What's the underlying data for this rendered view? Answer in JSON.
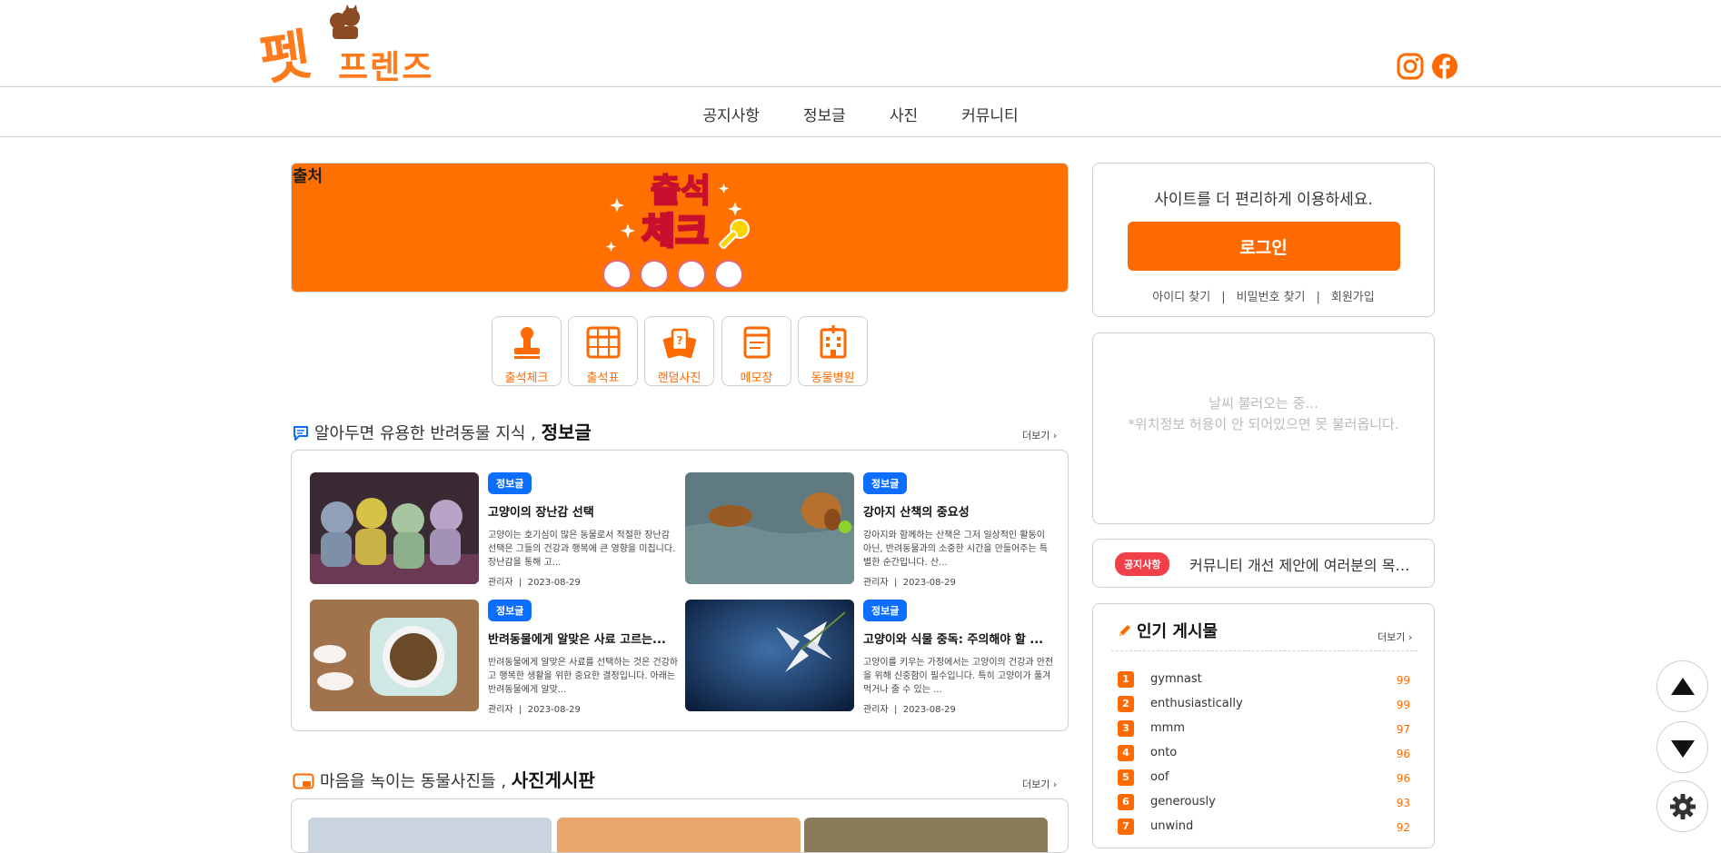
{
  "header": {
    "logo_text": "펫",
    "logo_sub": "프렌즈",
    "instagram_icon": "instagram-icon",
    "facebook_icon": "facebook-icon"
  },
  "nav": {
    "items": [
      {
        "label": "공지사항"
      },
      {
        "label": "정보글"
      },
      {
        "label": "사진"
      },
      {
        "label": "커뮤니티"
      }
    ]
  },
  "banner": {
    "source_label": "출처",
    "art_line1": "출석",
    "art_line2": "체크",
    "stamp_text": "출석체크"
  },
  "quick_menu": [
    {
      "label": "출석체크",
      "icon": "stamp-icon"
    },
    {
      "label": "출석표",
      "icon": "table-icon"
    },
    {
      "label": "랜덤사진",
      "icon": "cards-icon"
    },
    {
      "label": "메모장",
      "icon": "memo-icon"
    },
    {
      "label": "동물병원",
      "icon": "hospital-icon"
    }
  ],
  "info_section": {
    "heading_prefix": "알아두면 유용한 반려동물 지식 ,",
    "heading_strong": "정보글",
    "more": "더보기 ›",
    "posts": [
      {
        "badge": "정보글",
        "title": "고양이의 장난감 선택",
        "text": " 고양이는 호기심이 많은 동물로서 적절한 장난감 선택은 그들의 건강과 행복에 큰 영향을 미칩니다. 장난감을 통해 고...",
        "author": "관리자",
        "date": "2023-08-29"
      },
      {
        "badge": "정보글",
        "title": "강아지 산책의 중요성",
        "text": " 강아지와 함께하는 산책은 그저 일상적인 활동이 아닌, 반려동물과의 소중한 시간을 만들어주는 특별한 순간입니다. 산...",
        "author": "관리자",
        "date": "2023-08-29"
      },
      {
        "badge": "정보글",
        "title": "반려동물에게 알맞은 사료 고르는...",
        "text": " 반려동물에게 알맞은 사료를 선택하는 것은 건강하고 행복한 생활을 위한 중요한 결정입니다. 아래는 반려동물에게 알맞...",
        "author": "관리자",
        "date": "2023-08-29"
      },
      {
        "badge": "정보글",
        "title": "고양이와 식물 중독: 주의해야 할 ...",
        "text": " 고양이를 키우는 가정에서는 고양이의 건강과 안전을 위해 신중함이 필수입니다. 특히 고양이가 풀겨 먹거나 줄 수 있는 ...",
        "author": "관리자",
        "date": "2023-08-29"
      }
    ]
  },
  "photo_section": {
    "heading_prefix": "마음을 녹이는 동물사진들 ,",
    "heading_strong": "사진게시판",
    "more": "더보기 ›"
  },
  "login": {
    "message": "사이트를 더 편리하게 이용하세요.",
    "button": "로그인",
    "find_id": "아이디 찾기",
    "find_pw": "비밀번호 찾기",
    "signup": "회원가입",
    "sep": "|"
  },
  "weather": {
    "line1": "날씨 불러오는 중...",
    "line2": "*위치정보 허용이 안 되어있으면 못 불러옵니다."
  },
  "notice": {
    "badge": "공지사항",
    "text": "커뮤니티 개선 제안에 여러분의 목소리를 들려주세요"
  },
  "popular": {
    "title": "인기 게시물",
    "more": "더보기 ›",
    "items": [
      {
        "rank": "1",
        "name": "gymnast",
        "count": "99"
      },
      {
        "rank": "2",
        "name": "enthusiastically",
        "count": "99"
      },
      {
        "rank": "3",
        "name": "mmm",
        "count": "97"
      },
      {
        "rank": "4",
        "name": "onto",
        "count": "96"
      },
      {
        "rank": "5",
        "name": "oof",
        "count": "96"
      },
      {
        "rank": "6",
        "name": "generously",
        "count": "93"
      },
      {
        "rank": "7",
        "name": "unwind",
        "count": "92"
      }
    ]
  },
  "floating": {
    "up_icon": "arrow-up-icon",
    "down_icon": "arrow-down-icon",
    "settings_icon": "gear-icon"
  },
  "colors": {
    "accent": "#ff6a00",
    "badge_blue": "#0d6efd",
    "notice_red": "#f0404a"
  }
}
